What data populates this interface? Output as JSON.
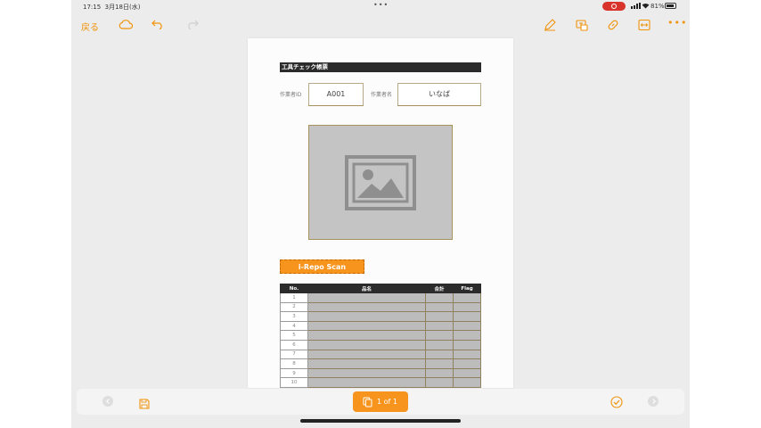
{
  "status_bar": {
    "time": "17:15",
    "date": "3月18日(水)",
    "battery": "81%"
  },
  "toolbar": {
    "back_label": "戻る"
  },
  "form": {
    "title": "工具チェック帳票",
    "worker_id_label": "作業者ID",
    "worker_id_value": "A001",
    "worker_name_label": "作業者名",
    "worker_name_value": "いなば",
    "scan_button": "i-Repo Scan",
    "table": {
      "headers": [
        "No.",
        "品名",
        "合計",
        "Flag"
      ],
      "rows": [
        "1",
        "2",
        "3",
        "4",
        "5",
        "6",
        "7",
        "8",
        "9",
        "10"
      ]
    }
  },
  "bottom_bar": {
    "page_indicator": "1 of 1"
  },
  "colors": {
    "accent": "#f7941e",
    "title_bar": "#2b2b2b"
  }
}
